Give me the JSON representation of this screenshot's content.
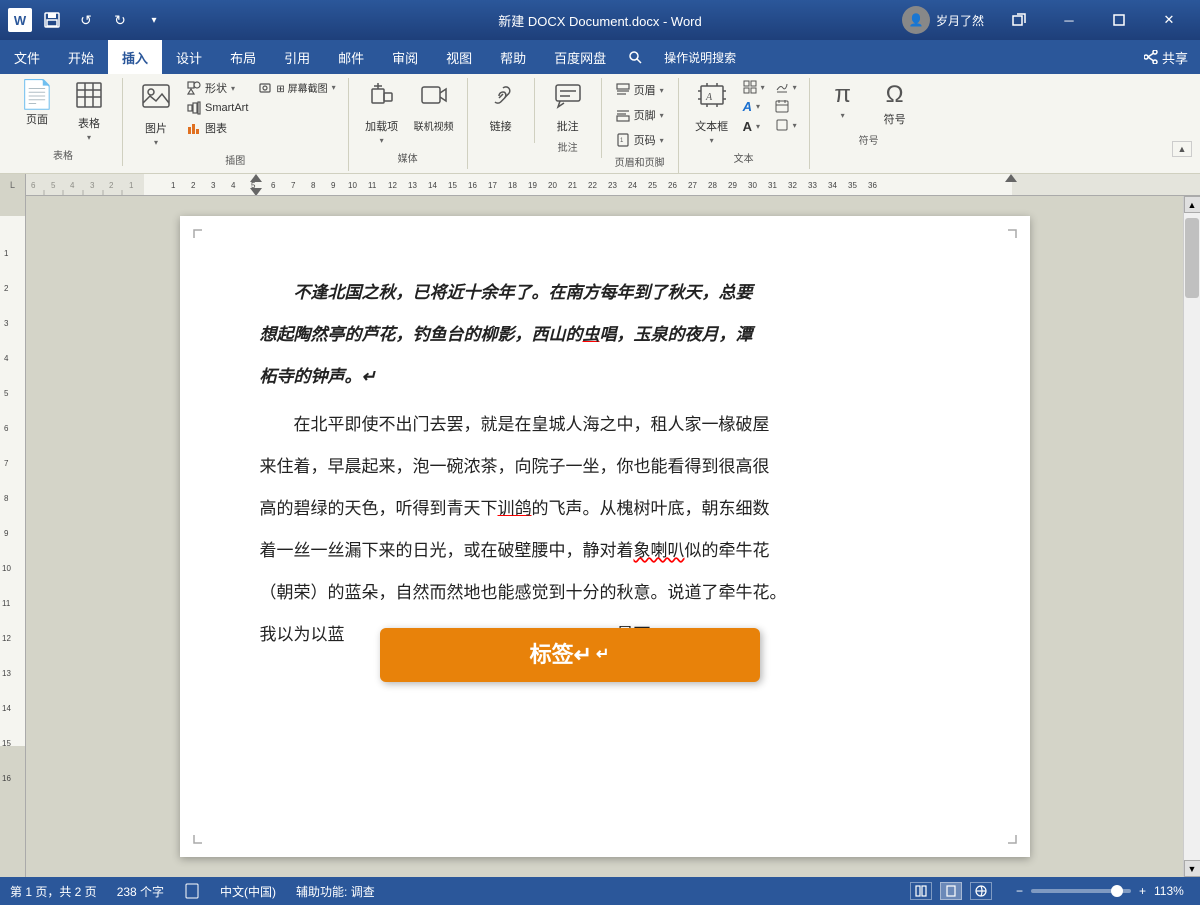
{
  "titlebar": {
    "title": "新建 DOCX Document.docx - Word",
    "username": "岁月了然",
    "save_icon": "💾",
    "undo_icon": "↺",
    "redo_icon": "↻",
    "min_icon": "─",
    "restore_icon": "❒",
    "close_icon": "✕"
  },
  "menubar": {
    "items": [
      "文件",
      "开始",
      "插入",
      "设计",
      "布局",
      "引用",
      "邮件",
      "审阅",
      "视图",
      "帮助",
      "百度网盘"
    ],
    "active": "插入",
    "share_label": "共享",
    "search_placeholder": "操作说明搜索"
  },
  "ribbon": {
    "groups": [
      {
        "label": "表格",
        "items": [
          {
            "id": "page",
            "icon": "📄",
            "label": "页面"
          },
          {
            "id": "table",
            "icon": "⊞",
            "label": "表格"
          }
        ]
      },
      {
        "label": "插图",
        "items": [
          {
            "id": "image",
            "icon": "🖼",
            "label": "图片"
          },
          {
            "id": "shape",
            "label": "形状▾",
            "small": true
          },
          {
            "id": "smartart",
            "label": "SmartArt",
            "small": true
          },
          {
            "id": "chart",
            "label": "图表",
            "small": true
          },
          {
            "id": "screenshot",
            "label": "屏幕截图▾",
            "small": true
          }
        ]
      },
      {
        "label": "媒体",
        "items": [
          {
            "id": "addins",
            "icon": "🔌",
            "label": "加载项▾"
          },
          {
            "id": "media",
            "icon": "🎬",
            "label": "联机视频"
          }
        ]
      },
      {
        "label": "",
        "items": [
          {
            "id": "link",
            "icon": "🔗",
            "label": "链接"
          }
        ]
      },
      {
        "label": "批注",
        "items": [
          {
            "id": "comment",
            "icon": "💬",
            "label": "批注"
          }
        ]
      },
      {
        "label": "页眉和页脚",
        "items": [
          {
            "id": "header",
            "label": "页眉▾"
          },
          {
            "id": "footer",
            "label": "页脚▾"
          },
          {
            "id": "pagenumber",
            "label": "页码▾"
          }
        ]
      },
      {
        "label": "文本",
        "items": [
          {
            "id": "textbox",
            "icon": "A",
            "label": "文本框"
          },
          {
            "id": "quickparts",
            "icon": "≡",
            "label": ""
          },
          {
            "id": "wordart",
            "icon": "A",
            "label": ""
          },
          {
            "id": "dropcap",
            "icon": "A",
            "label": ""
          },
          {
            "id": "signline",
            "icon": "✍",
            "label": ""
          },
          {
            "id": "datetime",
            "icon": "📅",
            "label": ""
          },
          {
            "id": "obj",
            "icon": "◻",
            "label": ""
          }
        ]
      },
      {
        "label": "符号",
        "items": [
          {
            "id": "equation",
            "icon": "π",
            "label": ""
          },
          {
            "id": "symbol",
            "icon": "Ω",
            "label": "符号"
          }
        ]
      }
    ]
  },
  "document": {
    "paragraphs": [
      {
        "id": 1,
        "text": "不逢北国之秋，已将近十余年了。在南方每年到了秋天，总要",
        "style": "italic"
      },
      {
        "id": 2,
        "text": "想起陶然亭的芦花，钓鱼台的柳影，西山的虫唱，玉泉的夜月，潭",
        "style": "normal"
      },
      {
        "id": 3,
        "text": "柘寺的钟声。↵",
        "style": "normal"
      },
      {
        "id": 4,
        "text": "在北平即使不出门去罢，就是在皇城人海之中，租人家一椽破屋",
        "style": "normal"
      },
      {
        "id": 5,
        "text": "来住着，早晨起来，泡一碗浓茶，向院子一坐，你也能看得到很高很",
        "style": "normal"
      },
      {
        "id": 6,
        "text": "高的碧绿的天色，听得到青天下训鸽的飞声。从槐树叶底，朝东细数",
        "style": "normal"
      },
      {
        "id": 7,
        "text": "着一丝一丝漏下来的日光，或在破壁腰中，静对着象喇叭似的牵牛花",
        "style": "normal"
      },
      {
        "id": 8,
        "text": "（朝荣）的蓝朵，自然而然地也能感觉到十分的秋意。说道了牵牛花。",
        "style": "normal"
      },
      {
        "id": 9,
        "text": "我以为以蓝色或白色者为佳，紫黑色次之，淡红色最下。↵",
        "style": "normal",
        "has_label": true
      }
    ],
    "label_tooltip": "标签↵"
  },
  "statusbar": {
    "page_info": "第 1 页，共 2 页",
    "word_count": "238 个字",
    "language": "中文(中国)",
    "accessibility": "辅助功能: 调查",
    "zoom_level": "113%",
    "views": [
      "阅读视图",
      "页面视图",
      "Web视图"
    ]
  },
  "ruler": {
    "marks": [
      "6",
      "5",
      "4",
      "3",
      "2",
      "1",
      "1",
      "2",
      "3",
      "4",
      "5",
      "6",
      "7",
      "8",
      "9",
      "10",
      "11",
      "12",
      "13",
      "14",
      "15",
      "16",
      "17",
      "18",
      "19",
      "20",
      "21",
      "22",
      "23",
      "24",
      "25",
      "26",
      "27",
      "28",
      "29",
      "30",
      "31",
      "32",
      "33",
      "34",
      "35",
      "36"
    ]
  }
}
